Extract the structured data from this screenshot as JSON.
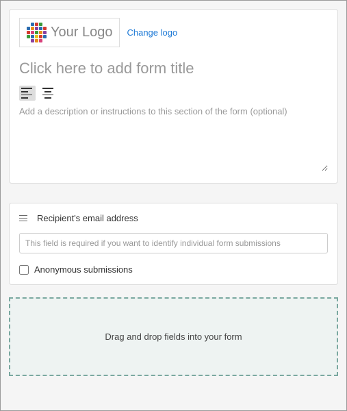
{
  "logo": {
    "placeholder_text": "Your Logo",
    "change_link": "Change logo"
  },
  "form": {
    "title_placeholder": "Click here to add form title",
    "description_placeholder": "Add a description or instructions to this section of the form (optional)"
  },
  "recipient": {
    "label": "Recipient's email address",
    "input_placeholder": "This field is required if you want to identify individual form submissions",
    "anonymous_label": "Anonymous submissions"
  },
  "dropzone": {
    "text": "Drag and drop fields into your form"
  }
}
